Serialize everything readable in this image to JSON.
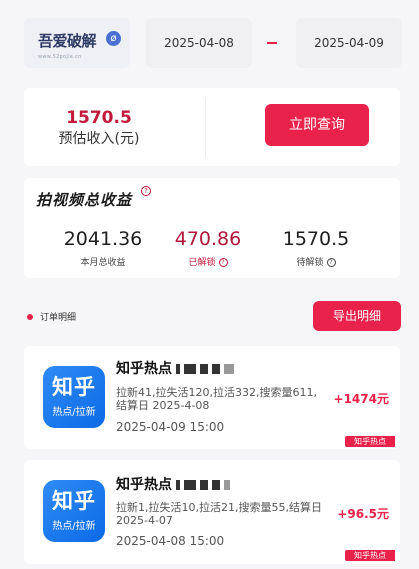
{
  "header": {
    "logo_text": "吾爱破解",
    "logo_sub": "www.52pojie.cn",
    "start_date": "2025-04-08",
    "end_date": "2025-04-09"
  },
  "query": {
    "estimated_value": "1570.5",
    "estimated_label": "预估收入(元)",
    "button_label": "立即查询"
  },
  "earnings": {
    "title": "拍视频总收益",
    "monthly_total_value": "2041.36",
    "monthly_total_label": "本月总收益",
    "unlocked_value": "470.86",
    "unlocked_label": "已解锁",
    "pending_value": "1570.5",
    "pending_label": "待解锁"
  },
  "orders_section": {
    "title": "订单明细",
    "export_label": "导出明细"
  },
  "orders": [
    {
      "icon_big": "知乎",
      "icon_small": "热点/拉新",
      "title": "知乎热点",
      "stats": "拉新41,拉失活120,拉活332,搜索量611,结算日 2025-4-08",
      "time": "2025-04-09 15:00",
      "amount": "+1474元",
      "tag": "知乎热点"
    },
    {
      "icon_big": "知乎",
      "icon_small": "热点/拉新",
      "title": "知乎热点",
      "stats": "拉新1,拉失活10,拉活21,搜索量55,结算日 2025-4-07",
      "time": "2025-04-08 15:00",
      "amount": "+96.5元",
      "tag": "知乎热点"
    }
  ],
  "colors": {
    "accent": "#e8224a",
    "estimate": "#c21a3c",
    "unlocked": "#b1173a",
    "icon_blue": "#1677ee"
  }
}
